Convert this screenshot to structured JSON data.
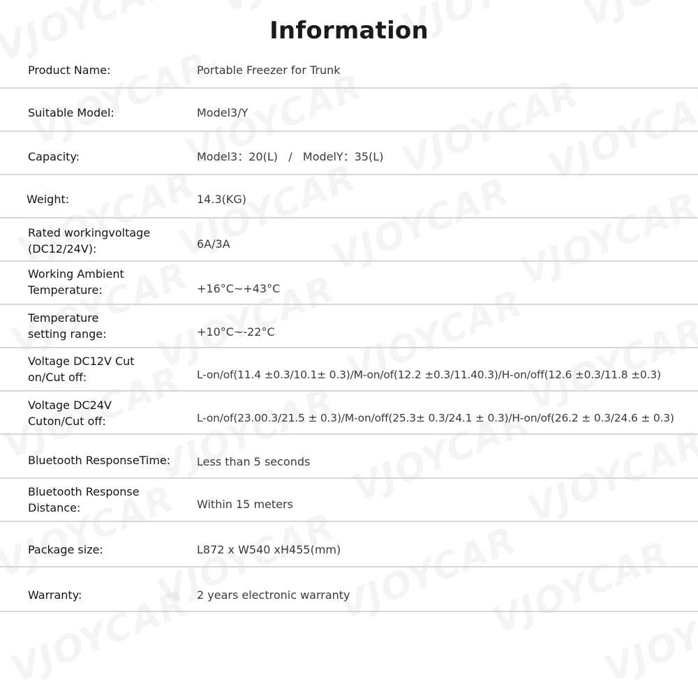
{
  "title": "Information",
  "watermark_text": "VJOYCAR",
  "rows": [
    {
      "label": "Product Name:",
      "value": "Portable Freezer for Trunk"
    },
    {
      "label": "Suitable Model:",
      "value": "Model3/Y"
    },
    {
      "label": "Capacity:",
      "value": "Model3：20(L)   /   ModelY：35(L)"
    },
    {
      "label": "Weight:",
      "value": "14.3(KG)"
    },
    {
      "label": "Rated workingvoltage (DC12/24V):",
      "value": "6A/3A"
    },
    {
      "label": "Working Ambient Temperature:",
      "value": "+16°C~+43°C"
    },
    {
      "label": "Temperature setting range:",
      "value": "+10°C~-22°C"
    },
    {
      "label": "Voltage DC12V Cut on/Cut off:",
      "value": "L-on/of(11.4 ±0.3/10.1± 0.3)/M-on/of(12.2 ±0.3/11.40.3)/H-on/off(12.6 ±0.3/11.8 ±0.3)"
    },
    {
      "label": "Voltage DC24V Cuton/Cut off:",
      "value": "L-on/of(23.00.3/21.5 ± 0.3)/M-on/off(25.3± 0.3/24.1 ± 0.3)/H-on/of(26.2 ± 0.3/24.6 ± 0.3)"
    },
    {
      "label": "Bluetooth ResponseTime:",
      "value": "Less than 5 seconds"
    },
    {
      "label": "Bluetooth Response Distance:",
      "value": "Within 15 meters"
    },
    {
      "label": "Package size:",
      "value": "L872 x W540 xH455(mm)"
    },
    {
      "label": "Warranty:",
      "value": "2 years electronic warranty"
    }
  ]
}
